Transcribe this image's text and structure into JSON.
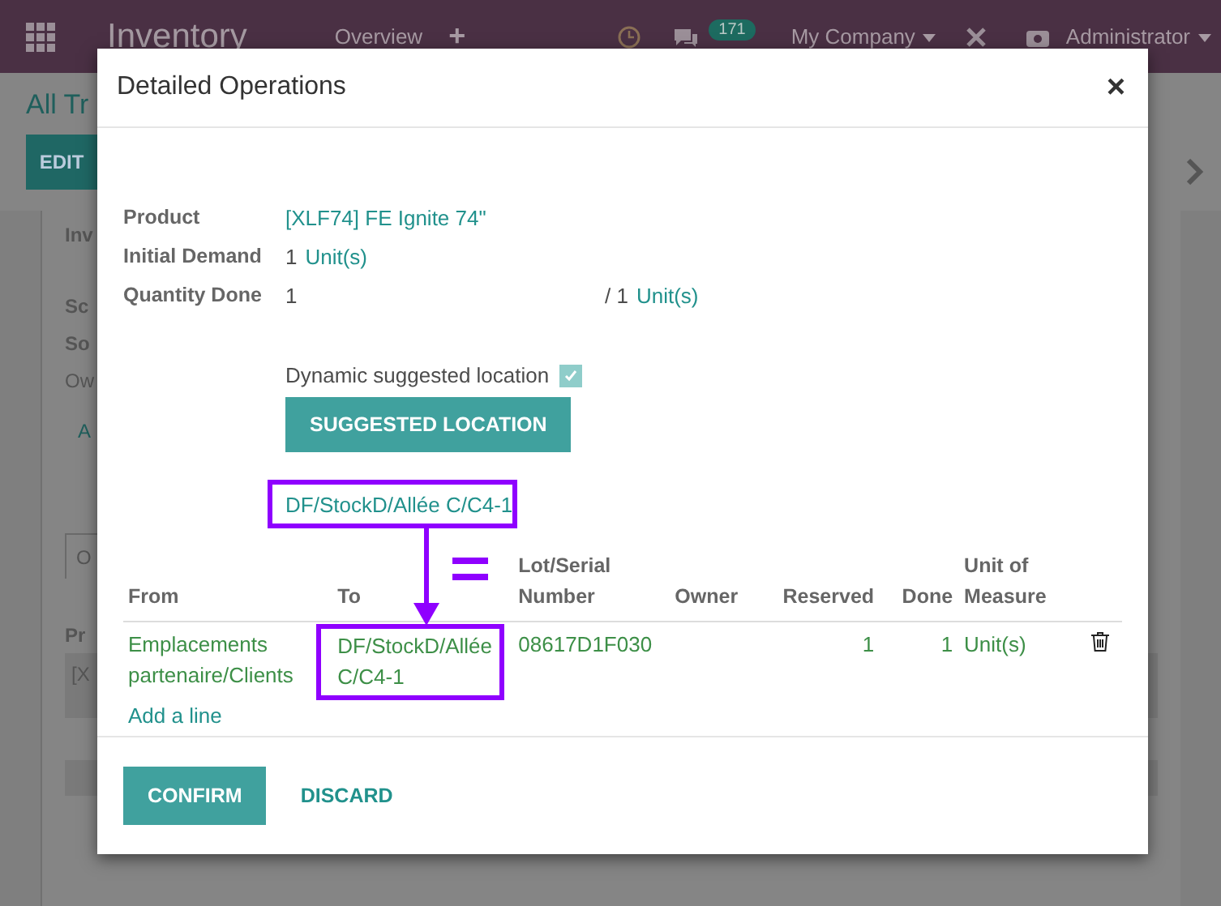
{
  "navbar": {
    "app_title": "Inventory",
    "menu": [
      "Overview",
      "+"
    ],
    "messages_badge": "171",
    "company": "My Company",
    "user": "Administrator"
  },
  "background": {
    "breadcrumb": "All Tr",
    "edit_button": "EDIT",
    "fields": [
      "Inv",
      "Sc",
      "So",
      "Ow"
    ],
    "smart_text": "A",
    "tab": "O",
    "table_header": "Pr",
    "table_cell": "[X"
  },
  "dialog": {
    "title": "Detailed Operations",
    "close": "×",
    "fields": [
      {
        "label": "Product",
        "kind": "link",
        "value": "[XLF74] FE Ignite 74\""
      },
      {
        "label": "Initial Demand",
        "kind": "quantity",
        "value": "1",
        "unit": "Unit(s)"
      },
      {
        "label": "Quantity Done",
        "kind": "done",
        "value": "1",
        "total": "/ 1",
        "unit": "Unit(s)"
      }
    ],
    "dynamic_location": {
      "label": "Dynamic suggested location",
      "checked": true
    },
    "suggest_button": "SUGGESTED LOCATION",
    "suggested_location": "DF/StockD/Allée C/C4-1",
    "table": {
      "columns": [
        "From",
        "To",
        "Lot/Serial Number",
        "Owner",
        "Reserved",
        "Done",
        "Unit of Measure"
      ],
      "rows": [
        {
          "from": "Emplacements partenaire/Clients",
          "to": "DF/StockD/Allée C/C4-1",
          "lot": "08617D1F030",
          "reserved": "1",
          "done": "1",
          "unit": "Unit(s)"
        }
      ],
      "add_line": "Add a line"
    },
    "buttons": [
      {
        "label": "CONFIRM",
        "kind": "primary"
      },
      {
        "label": "DISCARD",
        "kind": "link"
      }
    ]
  }
}
